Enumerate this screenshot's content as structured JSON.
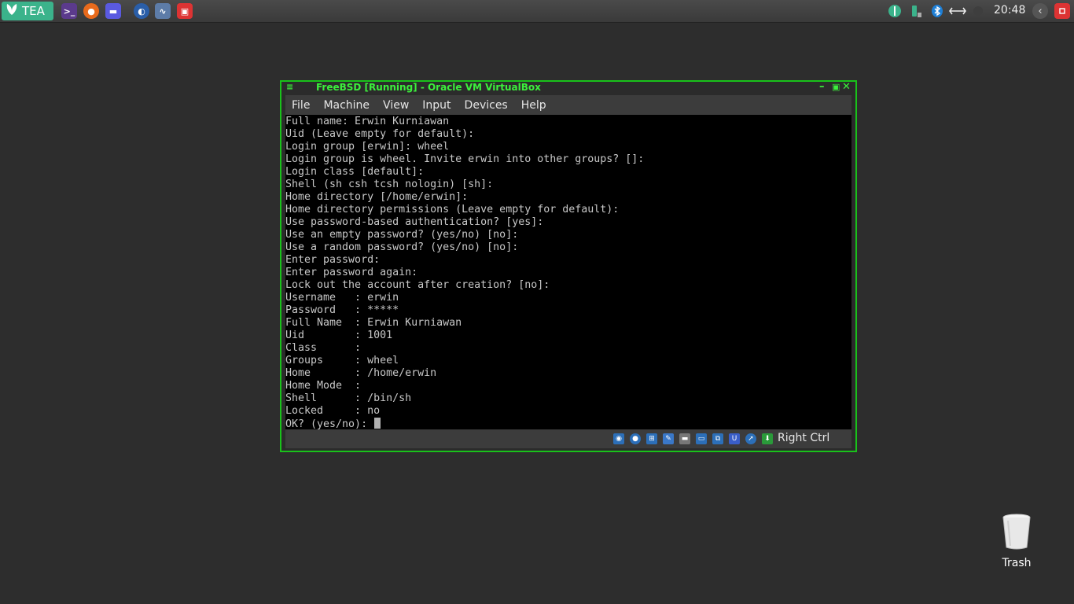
{
  "panel": {
    "menu_label": "TEA",
    "launchers": [
      "terminal-icon",
      "firefox-icon",
      "file-manager-icon",
      "browser-icon",
      "system-monitor-icon",
      "virtualbox-icon"
    ],
    "clock": "20:48"
  },
  "window": {
    "title": "FreeBSD [Running] - Oracle VM VirtualBox",
    "menu": [
      "File",
      "Machine",
      "View",
      "Input",
      "Devices",
      "Help"
    ],
    "host_key": "Right Ctrl"
  },
  "terminal": {
    "lines": [
      "Full name: Erwin Kurniawan",
      "Uid (Leave empty for default):",
      "Login group [erwin]: wheel",
      "Login group is wheel. Invite erwin into other groups? []:",
      "Login class [default]:",
      "Shell (sh csh tcsh nologin) [sh]:",
      "Home directory [/home/erwin]:",
      "Home directory permissions (Leave empty for default):",
      "Use password-based authentication? [yes]:",
      "Use an empty password? (yes/no) [no]:",
      "Use a random password? (yes/no) [no]:",
      "Enter password:",
      "Enter password again:",
      "Lock out the account after creation? [no]:",
      "Username   : erwin",
      "Password   : *****",
      "Full Name  : Erwin Kurniawan",
      "Uid        : 1001",
      "Class      :",
      "Groups     : wheel",
      "Home       : /home/erwin",
      "Home Mode  :",
      "Shell      : /bin/sh",
      "Locked     : no"
    ],
    "prompt": "OK? (yes/no): "
  },
  "desktop": {
    "trash_label": "Trash"
  },
  "colors": {
    "window_border": "#19c21a",
    "title_text": "#3cf03c",
    "menu_accent": "#3bb38b"
  }
}
